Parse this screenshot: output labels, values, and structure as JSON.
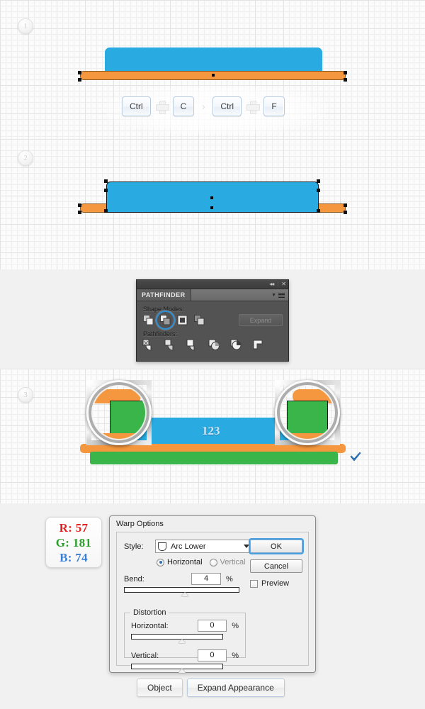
{
  "steps": [
    {
      "number": "1"
    },
    {
      "number": "2"
    },
    {
      "number": "3"
    }
  ],
  "shortcut": {
    "keys": [
      {
        "type": "key",
        "label": "Ctrl"
      },
      {
        "type": "plus",
        "label": "+"
      },
      {
        "type": "key",
        "label": "C"
      },
      {
        "type": "arrow",
        "label": "›"
      },
      {
        "type": "key",
        "label": "Ctrl"
      },
      {
        "type": "plus",
        "label": "+"
      },
      {
        "type": "key",
        "label": "F"
      }
    ]
  },
  "artwork": {
    "blue_color": "#29abe2",
    "orange_color": "#f4973e",
    "green_color": "#39b54a",
    "text_label": "123"
  },
  "pathfinder": {
    "tab_title": "PATHFINDER",
    "shape_modes_label": "Shape Modes:",
    "pathfinders_label": "Pathfinders:",
    "expand_label": "Expand",
    "collapse_icon": "◂◂",
    "close_icon": "✕",
    "shape_modes": [
      {
        "name": "unite-icon",
        "selected": false
      },
      {
        "name": "minus-front-icon",
        "selected": true
      },
      {
        "name": "intersect-icon",
        "selected": false
      },
      {
        "name": "exclude-icon",
        "selected": false
      }
    ],
    "pathfinder_modes": [
      {
        "name": "divide-icon"
      },
      {
        "name": "trim-icon"
      },
      {
        "name": "merge-icon"
      },
      {
        "name": "crop-icon"
      },
      {
        "name": "outline-icon"
      },
      {
        "name": "minus-back-icon"
      }
    ],
    "highlight_color": "#2e8fd4"
  },
  "rgb_swatch": {
    "r_label": "R: 57",
    "g_label": "G: 181",
    "b_label": "B: 74",
    "r_color": "#e0221f",
    "g_color": "#2aa02a",
    "b_color": "#3a7fd5"
  },
  "warp_dialog": {
    "title": "Warp Options",
    "style_label": "Style:",
    "style_value": "Arc Lower",
    "orientation": {
      "horizontal_label": "Horizontal",
      "vertical_label": "Vertical",
      "selected": "Horizontal"
    },
    "bend_label": "Bend:",
    "bend_value": "4",
    "bend_unit": "%",
    "distortion_label": "Distortion",
    "horizontal_label": "Horizontal:",
    "horizontal_value": "0",
    "horizontal_unit": "%",
    "vertical_label": "Vertical:",
    "vertical_value": "0",
    "vertical_unit": "%",
    "ok_label": "OK",
    "cancel_label": "Cancel",
    "preview_label": "Preview",
    "preview_checked": false
  },
  "bottom_buttons": {
    "object_label": "Object",
    "expand_appearance_label": "Expand Appearance"
  }
}
